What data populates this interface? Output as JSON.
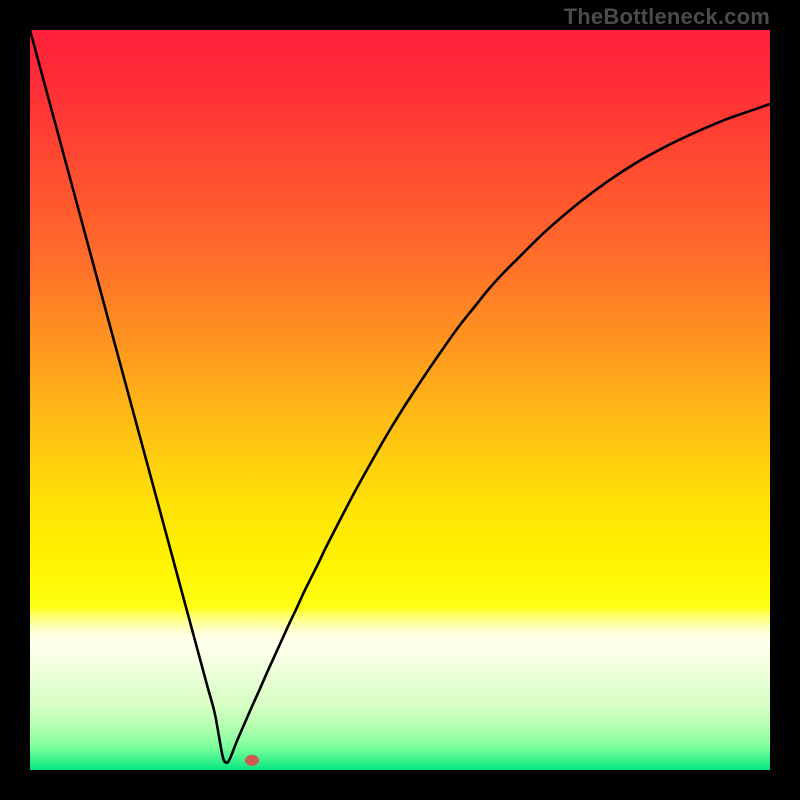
{
  "watermark": {
    "text": "TheBottleneck.com"
  },
  "chart_data": {
    "type": "line",
    "title": "",
    "xlabel": "",
    "ylabel": "",
    "xlim": [
      0,
      100
    ],
    "ylim": [
      0,
      100
    ],
    "x": [
      0,
      1,
      2,
      3,
      4,
      5,
      6,
      7,
      8,
      9,
      10,
      11,
      12,
      13,
      14,
      15,
      16,
      17,
      18,
      19,
      20,
      21,
      22,
      23,
      24,
      25,
      26,
      26.5,
      27,
      28,
      29,
      30,
      31,
      32,
      33,
      34,
      35,
      36,
      37,
      38,
      39,
      40,
      42,
      44,
      46,
      48,
      50,
      52,
      54,
      56,
      58,
      60,
      62,
      64,
      66,
      68,
      70,
      74,
      78,
      82,
      86,
      90,
      94,
      98,
      100
    ],
    "y": [
      100,
      96.3,
      92.6,
      88.9,
      85.2,
      81.5,
      77.8,
      74.1,
      70.4,
      66.7,
      63.0,
      59.3,
      55.6,
      51.9,
      48.2,
      44.5,
      40.8,
      37.1,
      33.4,
      29.7,
      26.0,
      22.3,
      18.6,
      14.9,
      11.2,
      7.5,
      2.0,
      1.0,
      1.5,
      4.0,
      6.3,
      8.6,
      10.8,
      13.1,
      15.3,
      17.5,
      19.7,
      21.8,
      24.0,
      26.0,
      28.0,
      30.1,
      34.0,
      37.8,
      41.4,
      44.9,
      48.2,
      51.3,
      54.3,
      57.2,
      60.0,
      62.5,
      65.0,
      67.2,
      69.2,
      71.2,
      73.1,
      76.5,
      79.5,
      82.1,
      84.3,
      86.2,
      87.9,
      89.3,
      90.0
    ],
    "marker": {
      "x": 30,
      "y": 1.3
    },
    "gradient_bands": [
      {
        "stop_pct": 0.0,
        "color": "#ff1f3a"
      },
      {
        "stop_pct": 8.0,
        "color": "#ff2f36"
      },
      {
        "stop_pct": 16.0,
        "color": "#ff4532"
      },
      {
        "stop_pct": 24.0,
        "color": "#ff5a2e"
      },
      {
        "stop_pct": 32.0,
        "color": "#ff7129"
      },
      {
        "stop_pct": 40.0,
        "color": "#ff8d22"
      },
      {
        "stop_pct": 48.0,
        "color": "#ffaa1a"
      },
      {
        "stop_pct": 56.0,
        "color": "#ffc711"
      },
      {
        "stop_pct": 64.0,
        "color": "#ffe106"
      },
      {
        "stop_pct": 72.0,
        "color": "#fff400"
      },
      {
        "stop_pct": 78.0,
        "color": "#ffff15"
      },
      {
        "stop_pct": 79.0,
        "color": "#ffff60"
      },
      {
        "stop_pct": 80.0,
        "color": "#ffff98"
      },
      {
        "stop_pct": 81.0,
        "color": "#ffffc8"
      },
      {
        "stop_pct": 82.0,
        "color": "#ffffe6"
      },
      {
        "stop_pct": 83.0,
        "color": "#feffed"
      },
      {
        "stop_pct": 91.0,
        "color": "#d9ffc5"
      },
      {
        "stop_pct": 94.0,
        "color": "#b7ffb2"
      },
      {
        "stop_pct": 97.0,
        "color": "#7bff9d"
      },
      {
        "stop_pct": 100.0,
        "color": "#05e67f"
      }
    ]
  }
}
